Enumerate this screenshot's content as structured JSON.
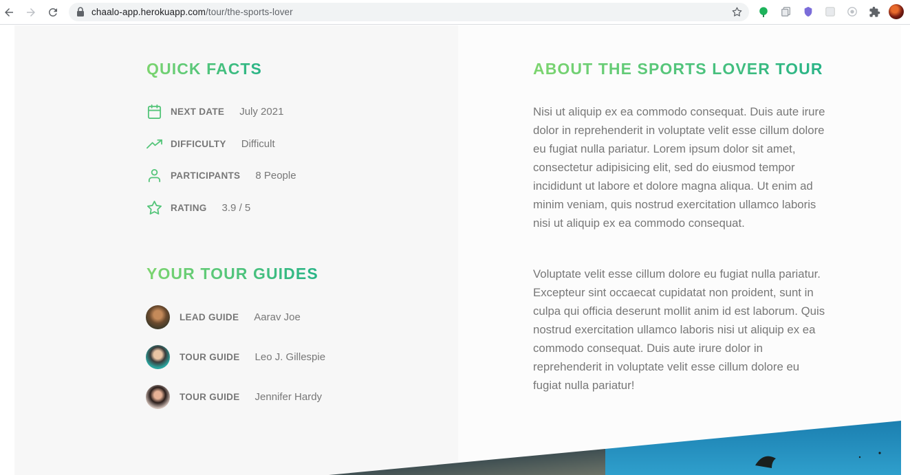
{
  "browser": {
    "url_host": "chaalo-app.herokuapp.com",
    "url_path": "/tour/the-sports-lover"
  },
  "quick_facts": {
    "heading": "QUICK FACTS",
    "items": [
      {
        "label": "NEXT DATE",
        "value": "July 2021",
        "icon": "calendar-icon"
      },
      {
        "label": "DIFFICULTY",
        "value": "Difficult",
        "icon": "trending-up-icon"
      },
      {
        "label": "PARTICIPANTS",
        "value": "8 People",
        "icon": "user-icon"
      },
      {
        "label": "RATING",
        "value": "3.9 / 5",
        "icon": "star-icon"
      }
    ]
  },
  "guides": {
    "heading": "YOUR TOUR GUIDES",
    "items": [
      {
        "role": "LEAD GUIDE",
        "name": "Aarav Joe"
      },
      {
        "role": "TOUR GUIDE",
        "name": "Leo J. Gillespie"
      },
      {
        "role": "TOUR GUIDE",
        "name": "Jennifer Hardy"
      }
    ]
  },
  "about": {
    "heading": "ABOUT THE SPORTS LOVER TOUR",
    "paragraphs": [
      "Nisi ut aliquip ex ea commodo consequat. Duis aute irure dolor in reprehenderit in voluptate velit esse cillum dolore eu fugiat nulla pariatur. Lorem ipsum dolor sit amet, consectetur adipisicing elit, sed do eiusmod tempor incididunt ut labore et dolore magna aliqua. Ut enim ad minim veniam, quis nostrud exercitation ullamco laboris nisi ut aliquip ex ea commodo consequat.",
      "Voluptate velit esse cillum dolore eu fugiat nulla pariatur. Excepteur sint occaecat cupidatat non proident, sunt in culpa qui officia deserunt mollit anim id est laborum. Quis nostrud exercitation ullamco laboris nisi ut aliquip ex ea commodo consequat. Duis aute irure dolor in reprehenderit in voluptate velit esse cillum dolore eu fugiat nulla pariatur!"
    ]
  },
  "colors": {
    "accent_start": "#7dd56f",
    "accent_end": "#28b487",
    "text": "#777777"
  }
}
